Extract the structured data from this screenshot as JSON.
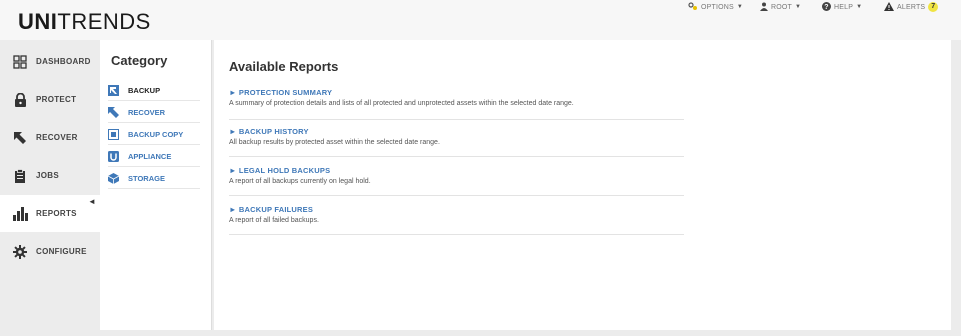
{
  "brand": {
    "bold": "UNI",
    "thin": "TRENDS"
  },
  "topnav": {
    "options_label": "OPTIONS",
    "user_label": "ROOT",
    "help_label": "HELP",
    "alerts_label": "ALERTS",
    "alerts_count": "7"
  },
  "sidebar": {
    "items": [
      {
        "label": "DASHBOARD",
        "icon": "dashboard-grid-icon"
      },
      {
        "label": "PROTECT",
        "icon": "lock-icon"
      },
      {
        "label": "RECOVER",
        "icon": "recover-arrow-icon"
      },
      {
        "label": "JOBS",
        "icon": "clipboard-icon"
      },
      {
        "label": "REPORTS",
        "icon": "bar-chart-icon",
        "active": true
      },
      {
        "label": "CONFIGURE",
        "icon": "gear-icon"
      }
    ]
  },
  "category": {
    "title": "Category",
    "items": [
      {
        "label": "BACKUP",
        "icon": "backup-icon",
        "active": true
      },
      {
        "label": "RECOVER",
        "icon": "recover-icon"
      },
      {
        "label": "BACKUP COPY",
        "icon": "backup-copy-icon"
      },
      {
        "label": "APPLIANCE",
        "icon": "appliance-icon"
      },
      {
        "label": "STORAGE",
        "icon": "storage-icon"
      }
    ]
  },
  "main": {
    "title": "Available Reports",
    "reports": [
      {
        "name": "► PROTECTION SUMMARY",
        "description": "A summary of protection details and lists of all protected and unprotected assets within the selected date range."
      },
      {
        "name": "► BACKUP HISTORY",
        "description": "All backup results by protected asset within the selected date range."
      },
      {
        "name": "► LEGAL HOLD BACKUPS",
        "description": "A report of all backups currently on legal hold."
      },
      {
        "name": "► BACKUP FAILURES",
        "description": "A report of all failed backups."
      }
    ]
  },
  "colors": {
    "link": "#3f78b8",
    "alert_badge": "#f0e442",
    "accent_icon": "#3f78b8"
  }
}
